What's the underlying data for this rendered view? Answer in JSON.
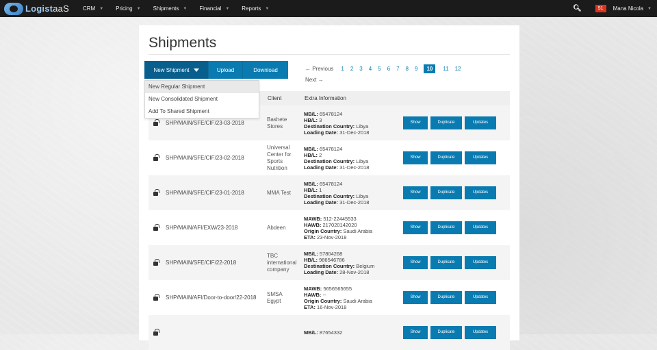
{
  "brand": {
    "name_main": "Logist",
    "name_suffix": "aaS"
  },
  "nav": [
    {
      "label": "CRM"
    },
    {
      "label": "Pricing"
    },
    {
      "label": "Shipments"
    },
    {
      "label": "Financial"
    },
    {
      "label": "Reports"
    }
  ],
  "topright": {
    "notification_count": "51",
    "user_name": "Mana Nicola"
  },
  "page": {
    "title": "Shipments"
  },
  "toolbar": {
    "new_label": "New Shipment",
    "upload_label": "Upload",
    "download_label": "Download"
  },
  "dropdown": {
    "items": [
      {
        "label": "New Regular Shipment"
      },
      {
        "label": "New Consolidated Shipment"
      },
      {
        "label": "Add To Shared Shipment"
      }
    ]
  },
  "pager": {
    "prev_label": "← Previous",
    "next_label": "Next →",
    "pages": [
      "1",
      "2",
      "3",
      "4",
      "5",
      "6",
      "7",
      "8",
      "9"
    ],
    "current": "10",
    "after": [
      "11",
      "12"
    ]
  },
  "table": {
    "headers": {
      "client": "Client",
      "extra": "Extra Information"
    },
    "action_labels": {
      "show": "Show",
      "duplicate": "Duplicate",
      "updates": "Updates"
    },
    "rows": [
      {
        "ref": "SHP/MAIN/SFE/CIF/23-03-2018",
        "client": "Bashete Stores",
        "l1k": "MB/L:",
        "l1v": " 65478124",
        "l2k": "HB/L:",
        "l2v": " 3",
        "l3k": "Destination Country:",
        "l3v": " Libya",
        "l4k": "Loading Date:",
        "l4v": " 31-Dec-2018"
      },
      {
        "ref": "SHP/MAIN/SFE/CIF/23-02-2018",
        "client": "Universal Center for Sports Nutrition",
        "l1k": "MB/L:",
        "l1v": " 65478124",
        "l2k": "HB/L:",
        "l2v": " 2",
        "l3k": "Destination Country:",
        "l3v": " Libya",
        "l4k": "Loading Date:",
        "l4v": " 31-Dec-2018"
      },
      {
        "ref": "SHP/MAIN/SFE/CIF/23-01-2018",
        "client": "MMA Test",
        "l1k": "MB/L:",
        "l1v": " 65478124",
        "l2k": "HB/L:",
        "l2v": " 1",
        "l3k": "Destination Country:",
        "l3v": " Libya",
        "l4k": "Loading Date:",
        "l4v": " 31-Dec-2018"
      },
      {
        "ref": "SHP/MAIN/AFI/EXW/23-2018",
        "client": "Abdeen",
        "l1k": "MAWB:",
        "l1v": " 512-22445533",
        "l2k": "HAWB:",
        "l2v": " 217020142020",
        "l3k": "Origin Country:",
        "l3v": " Saudi Arabia",
        "l4k": "ETA:",
        "l4v": " 23-Nov-2018"
      },
      {
        "ref": "SHP/MAIN/SFE/CIF/22-2018",
        "client": "TBC international company",
        "l1k": "MB/L:",
        "l1v": " 57804268",
        "l2k": "HB/L:",
        "l2v": " 986546786",
        "l3k": "Destination Country:",
        "l3v": " Belgium",
        "l4k": "Loading Date:",
        "l4v": " 28-Nov-2018"
      },
      {
        "ref": "SHP/MAIN/AFI/Door-to-door/22-2018",
        "client": "SMSA Egypt",
        "l1k": "MAWB:",
        "l1v": " 5656565655",
        "l2k": "HAWB:",
        "l2v": " --",
        "l3k": "Origin Country:",
        "l3v": " Saudi Arabia",
        "l4k": "ETA:",
        "l4v": " 16-Nov-2018"
      },
      {
        "ref": "",
        "client": "",
        "l1k": "MB/L:",
        "l1v": " 87654332",
        "l2k": "",
        "l2v": "",
        "l3k": "",
        "l3v": "",
        "l4k": "",
        "l4v": ""
      }
    ]
  }
}
